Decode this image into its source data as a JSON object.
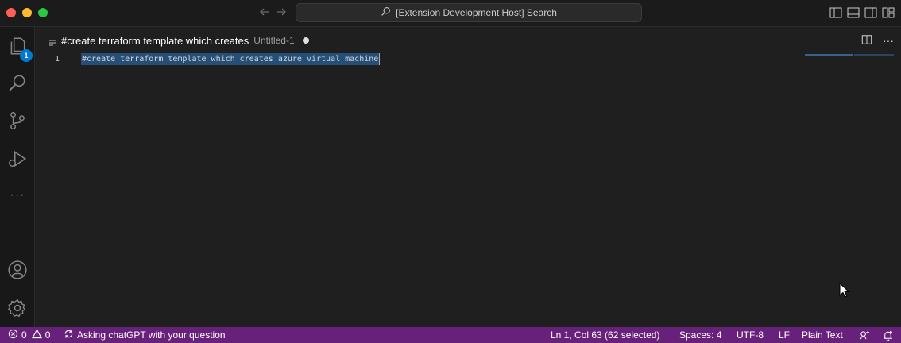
{
  "titlebar": {
    "search_text": "[Extension Development Host] Search",
    "icons": [
      "back-arrow-icon",
      "forward-arrow-icon",
      "search-icon",
      "toggle-sidebar-icon",
      "toggle-panel-icon",
      "toggle-secondary-sidebar-icon",
      "customize-layout-icon"
    ]
  },
  "activitybar": {
    "items": [
      "explorer",
      "search",
      "source-control",
      "run-and-debug",
      "more"
    ],
    "explorer_badge": "1",
    "more_label": "···",
    "bottom": [
      "accounts",
      "manage"
    ]
  },
  "tab": {
    "title": "#create terraform template which creates",
    "description": "Untitled-1",
    "dirty": true
  },
  "editor": {
    "line_number": "1",
    "line_text": "#create terraform template which creates azure virtual machine",
    "actions_more": "···"
  },
  "statusbar": {
    "errors": "0",
    "warnings": "0",
    "progress_text": "Asking chatGPT with your question",
    "cursor_position": "Ln 1, Col 63 (62 selected)",
    "spaces": "Spaces: 4",
    "encoding": "UTF-8",
    "eol": "LF",
    "language": "Plain Text"
  },
  "colors": {
    "statusbar_bg": "#68217a",
    "selection": "#264f78",
    "badge": "#0078d4"
  }
}
